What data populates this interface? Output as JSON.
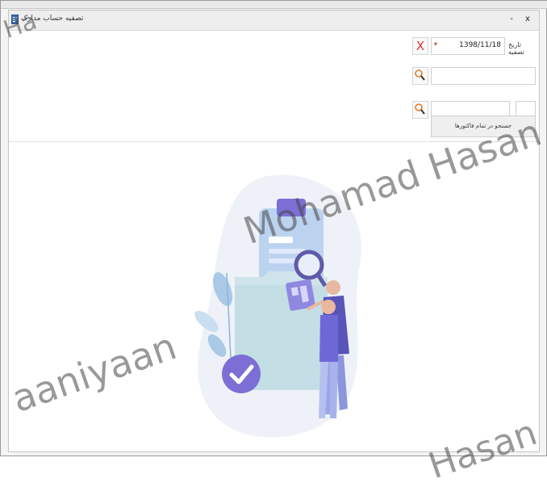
{
  "window": {
    "title": "تصفیه حساب مدارک",
    "minimize": "-",
    "close": "x"
  },
  "form": {
    "date_label": "تاریخ تصفیه",
    "date_value": "1398/11/18",
    "clear_symbol": "X",
    "search_all_invoices_label": "جستجو در تمام فاکتورها"
  },
  "watermarks": {
    "text_1": "Mohamad Hasan",
    "text_2": "aaniyaan",
    "text_3": "Hasan",
    "text_4": "Ha"
  },
  "colors": {
    "clear_red": "#e23232",
    "search_orange": "#e07a2a",
    "illustration_purple": "#7b6fd6"
  }
}
